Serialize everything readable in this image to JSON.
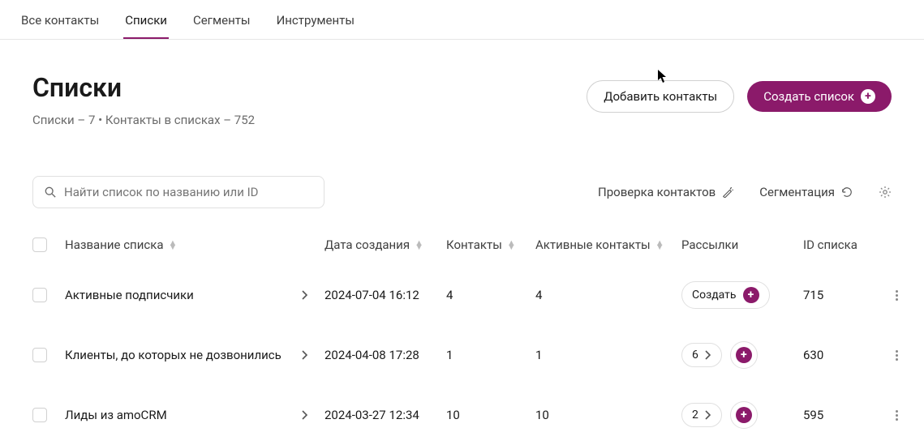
{
  "tabs": [
    "Все контакты",
    "Списки",
    "Сегменты",
    "Инструменты"
  ],
  "active_tab": 1,
  "page": {
    "title": "Списки",
    "subtitle": "Списки – 7 • Контакты в списках – 752"
  },
  "buttons": {
    "add_contacts": "Добавить контакты",
    "create_list": "Создать список"
  },
  "search": {
    "placeholder": "Найти список по названию или ID"
  },
  "controls": {
    "verify": "Проверка контактов",
    "segmentation": "Сегментация"
  },
  "columns": {
    "name": "Название списка",
    "created": "Дата создания",
    "contacts": "Контакты",
    "active": "Активные контакты",
    "campaigns": "Рассылки",
    "id": "ID списка"
  },
  "create_label": "Создать",
  "rows": [
    {
      "name": "Активные подписчики",
      "created": "2024-07-04 16:12",
      "contacts": "4",
      "active": "4",
      "campaigns": null,
      "id": "715"
    },
    {
      "name": "Клиенты, до которых не дозвонились",
      "created": "2024-04-08 17:28",
      "contacts": "1",
      "active": "1",
      "campaigns": "6",
      "id": "630"
    },
    {
      "name": "Лиды из amoCRM",
      "created": "2024-03-27 12:34",
      "contacts": "10",
      "active": "10",
      "campaigns": "2",
      "id": "595"
    }
  ]
}
